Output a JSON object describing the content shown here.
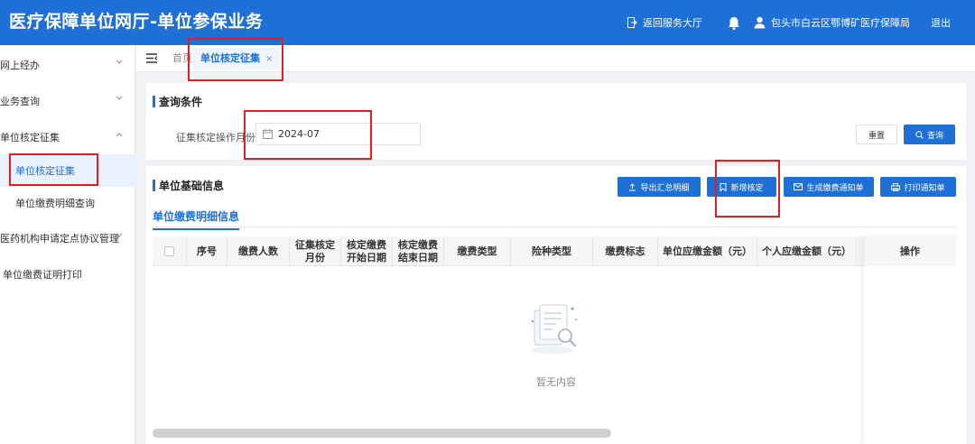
{
  "header": {
    "title": "医疗保障单位网厅-单位参保业务",
    "back_label": "返回服务大厅",
    "user_name": "包头市白云区鄂博矿医疗保障局",
    "logout_label": "退出"
  },
  "sidebar": {
    "items": [
      {
        "label": "网上经办",
        "has_chevron": true
      },
      {
        "label": "业务查询",
        "has_chevron": true
      },
      {
        "label": "单位核定征集",
        "has_chevron": true,
        "expanded": true
      },
      {
        "label": "单位核定征集",
        "active": true
      },
      {
        "label": "单位缴费明细查询"
      },
      {
        "label": "医药机构申请定点协议管理",
        "has_chevron": true
      },
      {
        "label": "单位缴费证明打印"
      }
    ]
  },
  "tabs": {
    "home": "首页",
    "active": "单位核定征集",
    "close": "×"
  },
  "query": {
    "title": "查询条件",
    "month_label": "征集核定操作月份",
    "month_value": "2024-07",
    "reset_label": "重置",
    "search_label": "查询"
  },
  "info": {
    "title": "单位基础信息",
    "buttons": {
      "export": "导出汇总明细",
      "add": "新增核定",
      "notice": "生成缴费通知单",
      "print": "打印通知单"
    },
    "subtab": "单位缴费明细信息",
    "columns": [
      "序号",
      "缴费人数",
      "征集核定\n月份",
      "核定缴费\n开始日期",
      "核定缴费\n结束日期",
      "缴费类型",
      "险种类型",
      "缴费标志",
      "单位应缴金额（元）",
      "个人应缴金额（元）",
      "操作"
    ],
    "empty_text": "暂无内容"
  },
  "colors": {
    "primary": "#1e6fd6",
    "highlight": "#e02020"
  }
}
